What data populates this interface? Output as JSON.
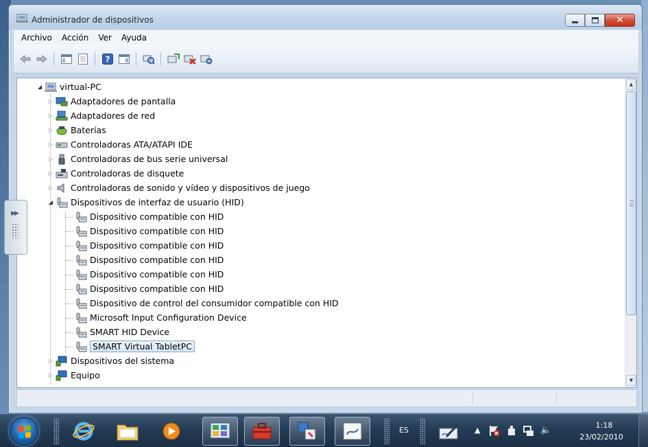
{
  "window": {
    "title": "Administrador de dispositivos",
    "buttons": {
      "minimize": "minimize",
      "maximize": "maximize",
      "close": "close"
    }
  },
  "menu": [
    "Archivo",
    "Acción",
    "Ver",
    "Ayuda"
  ],
  "toolbar": {
    "icons": [
      "back-icon",
      "forward-icon",
      "show-hide-console-tree-icon",
      "properties-icon",
      "help-icon",
      "show-action-pane-icon",
      "scan-hardware-icon",
      "update-driver-icon",
      "uninstall-icon",
      "disable-icon"
    ]
  },
  "tree": {
    "root": {
      "label": "virtual-PC"
    },
    "categories": [
      {
        "label": "Adaptadores de pantalla",
        "icon": "display-adapter-icon"
      },
      {
        "label": "Adaptadores de red",
        "icon": "network-adapter-icon"
      },
      {
        "label": "Baterías",
        "icon": "battery-icon"
      },
      {
        "label": "Controladoras ATA/ATAPI IDE",
        "icon": "ide-controller-icon"
      },
      {
        "label": "Controladoras de bus serie universal",
        "icon": "usb-icon"
      },
      {
        "label": "Controladoras de disquete",
        "icon": "floppy-controller-icon"
      },
      {
        "label": "Controladoras de sonido y vídeo y dispositivos de juego",
        "icon": "speaker-icon"
      },
      {
        "label": "Dispositivos de interfaz de usuario (HID)",
        "icon": "hid-icon"
      }
    ],
    "hid_children": [
      "Dispositivo compatible con HID",
      "Dispositivo compatible con HID",
      "Dispositivo compatible con HID",
      "Dispositivo compatible con HID",
      "Dispositivo compatible con HID",
      "Dispositivo compatible con HID",
      "Dispositivo de control del consumidor compatible con HID",
      "Microsoft Input Configuration Device",
      "SMART HID Device",
      "SMART Virtual TabletPC"
    ],
    "selected": "SMART Virtual TabletPC",
    "after": [
      {
        "label": "Dispositivos del sistema",
        "icon": "system-devices-icon"
      },
      {
        "label": "Equipo",
        "icon": "computer-icon"
      }
    ]
  },
  "taskbar": {
    "language": "ES",
    "time": "1:18",
    "date": "23/02/2010",
    "apps": [
      "internet-explorer-icon",
      "explorer-folder-icon",
      "media-player-icon",
      "control-panel-icon",
      "toolbox-icon",
      "device-manager-icon",
      "snipping-tool-icon"
    ],
    "tray_icons": [
      "pen-input-icon",
      "show-hidden-icons-icon",
      "action-center-icon",
      "power-icon",
      "network-icon",
      "volume-icon"
    ]
  },
  "colors": {
    "accent": "#7da2ce",
    "close_button": "#c2381f",
    "taskbar": "#243c55"
  }
}
